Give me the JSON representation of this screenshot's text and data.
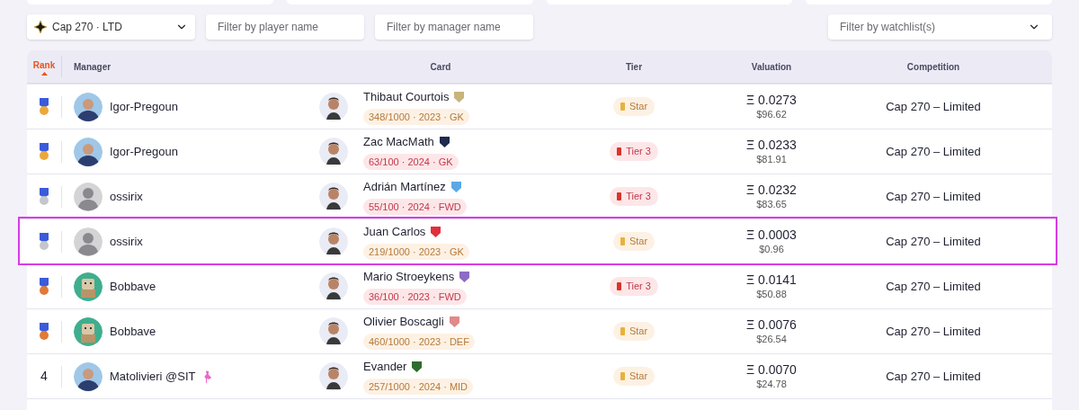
{
  "filters": {
    "competition": {
      "value": "Cap 270 · LTD"
    },
    "player": {
      "placeholder": "Filter by player name"
    },
    "manager": {
      "placeholder": "Filter by manager name"
    },
    "watchlist": {
      "placeholder": "Filter by watchlist(s)"
    }
  },
  "table": {
    "columns": [
      {
        "label": "Rank",
        "sorted": true
      },
      {
        "label": "Manager",
        "sorted": false
      },
      {
        "label": "Card",
        "sorted": false
      },
      {
        "label": "Tier",
        "sorted": false
      },
      {
        "label": "Valuation",
        "sorted": false
      },
      {
        "label": "Competition",
        "sorted": false
      }
    ],
    "rows": [
      {
        "selected": false,
        "rank": {
          "kind": "gold"
        },
        "manager": {
          "name": "Igor-Pregoun",
          "kind": "photo"
        },
        "card": {
          "player": "Thibaut Courtois",
          "color": "#c8b47c",
          "details": "348/1000 · 2023 · GK",
          "kind": "star"
        },
        "tier": "Star",
        "valuation": {
          "eth": "Ξ 0.0273",
          "usd": "$96.62"
        },
        "competition": "Cap 270 – Limited"
      },
      {
        "selected": false,
        "rank": {
          "kind": "gold"
        },
        "manager": {
          "name": "Igor-Pregoun",
          "kind": "photo"
        },
        "card": {
          "player": "Zac MacMath",
          "color": "#1f2a4d",
          "details": "63/100 · 2024 · GK",
          "kind": "tier3"
        },
        "tier": "Tier 3",
        "valuation": {
          "eth": "Ξ 0.0233",
          "usd": "$81.91"
        },
        "competition": "Cap 270 – Limited"
      },
      {
        "selected": false,
        "rank": {
          "kind": "silver"
        },
        "manager": {
          "name": "ossirix",
          "kind": "default"
        },
        "card": {
          "player": "Adrián Martínez",
          "color": "#5aa9e6",
          "details": "55/100 · 2024 · FWD",
          "kind": "tier3"
        },
        "tier": "Tier 3",
        "valuation": {
          "eth": "Ξ 0.0232",
          "usd": "$83.65"
        },
        "competition": "Cap 270 – Limited"
      },
      {
        "selected": true,
        "rank": {
          "kind": "silver"
        },
        "manager": {
          "name": "ossirix",
          "kind": "default"
        },
        "card": {
          "player": "Juan Carlos",
          "color": "#e0303c",
          "details": "219/1000 · 2023 · GK",
          "kind": "star"
        },
        "tier": "Star",
        "valuation": {
          "eth": "Ξ 0.0003",
          "usd": "$0.96"
        },
        "competition": "Cap 270 – Limited"
      },
      {
        "selected": false,
        "rank": {
          "kind": "bronze"
        },
        "manager": {
          "name": "Bobbave",
          "kind": "robot"
        },
        "card": {
          "player": "Mario Stroeykens",
          "color": "#8c6cc4",
          "details": "36/100 · 2023 · FWD",
          "kind": "tier3"
        },
        "tier": "Tier 3",
        "valuation": {
          "eth": "Ξ 0.0141",
          "usd": "$50.88"
        },
        "competition": "Cap 270 – Limited"
      },
      {
        "selected": false,
        "rank": {
          "kind": "bronze"
        },
        "manager": {
          "name": "Bobbave",
          "kind": "robot"
        },
        "card": {
          "player": "Olivier Boscagli",
          "color": "#e08a8a",
          "details": "460/1000 · 2023 · DEF",
          "kind": "star"
        },
        "tier": "Star",
        "valuation": {
          "eth": "Ξ 0.0076",
          "usd": "$26.54"
        },
        "competition": "Cap 270 – Limited"
      },
      {
        "selected": false,
        "rank": {
          "kind": "number",
          "text": "4"
        },
        "manager": {
          "name": "Matolivieri @SIT",
          "kind": "photo",
          "flamingo": true
        },
        "card": {
          "player": "Evander",
          "color": "#2f6b2f",
          "details": "257/1000 · 2024 · MID",
          "kind": "star"
        },
        "tier": "Star",
        "valuation": {
          "eth": "Ξ 0.0070",
          "usd": "$24.78"
        },
        "competition": "Cap 270 – Limited"
      }
    ]
  }
}
